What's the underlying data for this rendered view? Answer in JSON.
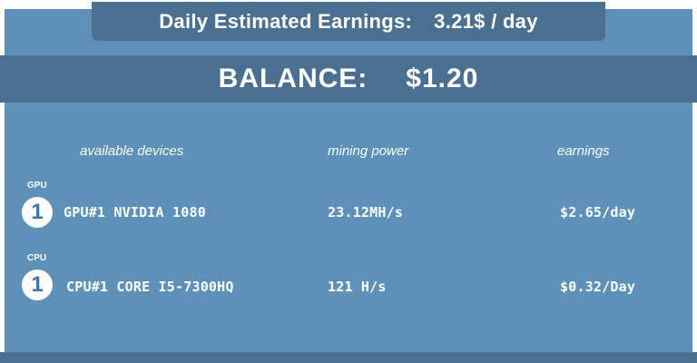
{
  "header": {
    "earnings_label": "Daily Estimated Earnings:",
    "earnings_value": "3.21$ / day",
    "balance_label": "BALANCE:",
    "balance_value": "$1.20"
  },
  "table": {
    "headers": {
      "devices": "available devices",
      "power": "mining power",
      "earnings": "earnings"
    },
    "rows": [
      {
        "type": "GPU",
        "count": "1",
        "device": "GPU#1 NVIDIA 1080",
        "power": "23.12MH/s",
        "earnings": "$2.65/day"
      },
      {
        "type": "CPU",
        "count": "1",
        "device": "CPU#1 CORE I5-7300HQ",
        "power": "121 H/s",
        "earnings": "$0.32/Day"
      }
    ]
  },
  "colors": {
    "panel": "#5d91b9",
    "bar": "#4a6f90",
    "text": "#ffffff",
    "badge_text": "#3f75a8"
  }
}
